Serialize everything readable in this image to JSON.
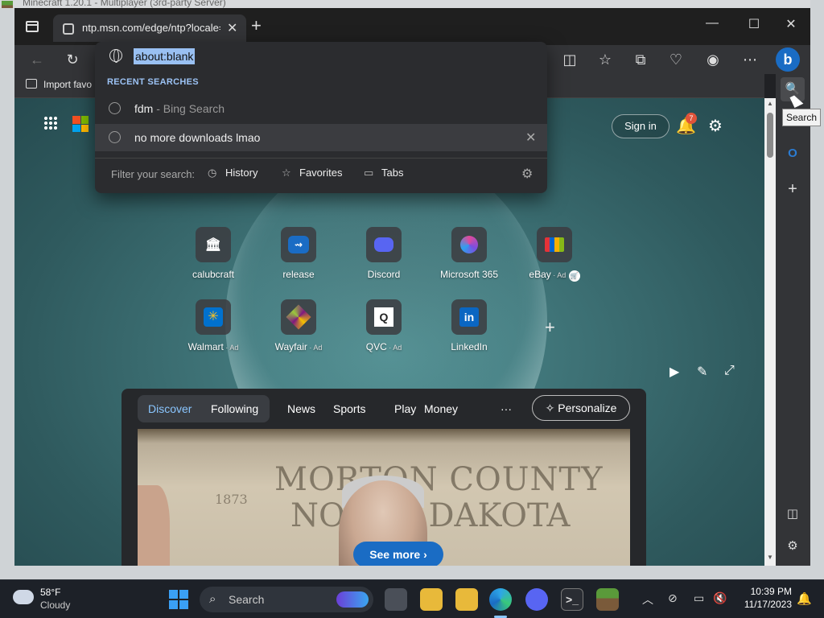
{
  "behind_window": {
    "title": "Minecraft 1.20.1 - Multiplayer (3rd-party Server)"
  },
  "browser": {
    "tab": {
      "title": "ntp.msn.com/edge/ntp?locale=e"
    },
    "favorites_bar": {
      "import": "Import favo"
    },
    "address": {
      "value": "about:blank"
    },
    "dropdown": {
      "section_label": "RECENT SEARCHES",
      "suggestions": [
        {
          "text": "fdm",
          "sub": " - Bing Search"
        },
        {
          "text": "no more downloads lmao",
          "sub": ""
        }
      ],
      "filter_label": "Filter your search:",
      "filters": [
        "History",
        "Favorites",
        "Tabs"
      ]
    },
    "sidebar_tooltip": "Search"
  },
  "ntp": {
    "signin": "Sign in",
    "notification_count": "7",
    "tiles": [
      {
        "label": "calubcraft",
        "ad": ""
      },
      {
        "label": "release",
        "ad": ""
      },
      {
        "label": "Discord",
        "ad": ""
      },
      {
        "label": "Microsoft 365",
        "ad": ""
      },
      {
        "label": "eBay",
        "ad": " · Ad"
      },
      {
        "label": "Walmart",
        "ad": " · Ad"
      },
      {
        "label": "Wayfair",
        "ad": " · Ad"
      },
      {
        "label": "QVC",
        "ad": " · Ad"
      },
      {
        "label": "LinkedIn",
        "ad": ""
      }
    ],
    "feed": {
      "tabs": [
        "Discover",
        "Following",
        "News",
        "Sports",
        "Play",
        "Money"
      ],
      "more": "···",
      "personalize": "Personalize",
      "image_sign": {
        "line1": "MORTON COUNTY",
        "line2": "NORTH DAKOTA",
        "year": "1873"
      },
      "see_more": "See more"
    }
  },
  "taskbar": {
    "weather": {
      "temp": "58°F",
      "desc": "Cloudy"
    },
    "search_placeholder": "Search",
    "time": "10:39 PM",
    "date": "11/17/2023"
  },
  "colors": {
    "accent": "#1a6cc4",
    "selection": "#99c0f2",
    "badge": "#e0533a"
  }
}
